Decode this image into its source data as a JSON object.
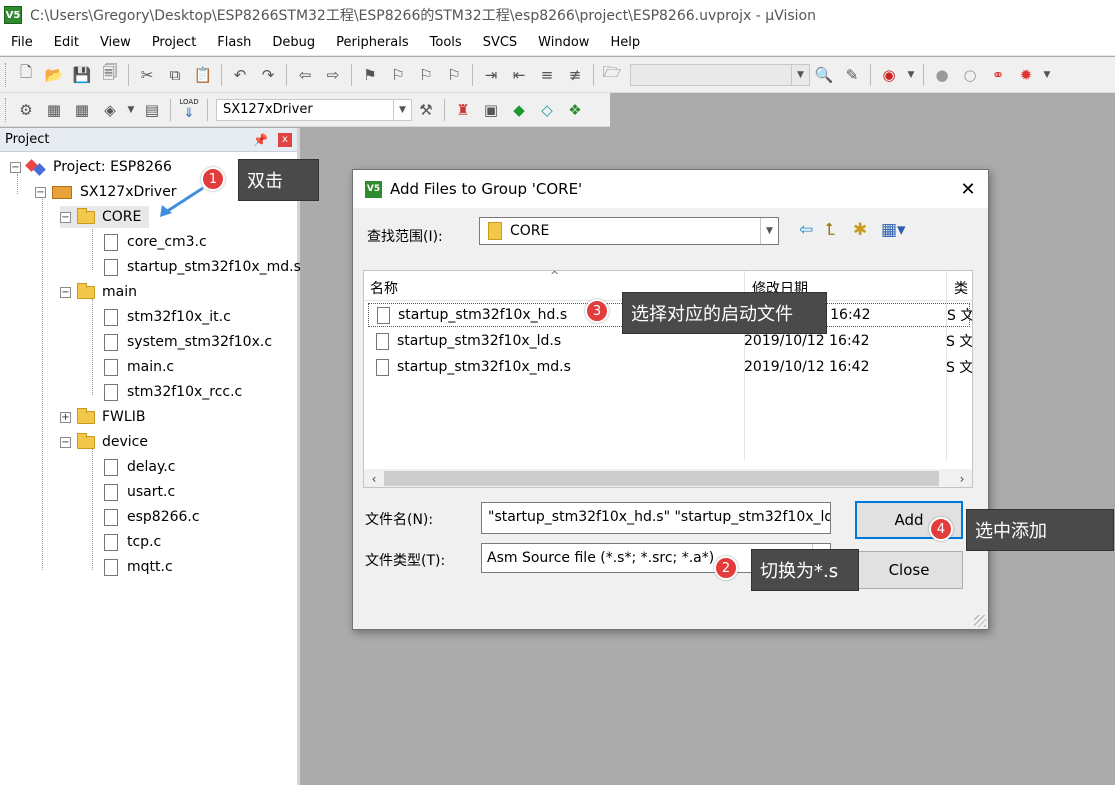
{
  "window": {
    "title": "C:\\Users\\Gregory\\Desktop\\ESP8266STM32工程\\ESP8266的STM32工程\\esp8266\\project\\ESP8266.uvprojx - µVision",
    "icon_label": "V5"
  },
  "menu": [
    "File",
    "Edit",
    "View",
    "Project",
    "Flash",
    "Debug",
    "Peripherals",
    "Tools",
    "SVCS",
    "Window",
    "Help"
  ],
  "toolbar2": {
    "target": "SX127xDriver",
    "load_label": "LOAD"
  },
  "project_panel": {
    "title": "Project",
    "pin": "ᵖ",
    "close": "x",
    "project_label": "Project: ESP8266",
    "target": "SX127xDriver",
    "groups": [
      {
        "name": "CORE",
        "expanded": "−",
        "files": [
          "core_cm3.c",
          "startup_stm32f10x_md.s"
        ]
      },
      {
        "name": "main",
        "expanded": "−",
        "files": [
          "stm32f10x_it.c",
          "system_stm32f10x.c",
          "main.c",
          "stm32f10x_rcc.c"
        ]
      },
      {
        "name": "FWLIB",
        "expanded": "+",
        "files": []
      },
      {
        "name": "device",
        "expanded": "−",
        "files": [
          "delay.c",
          "usart.c",
          "esp8266.c",
          "tcp.c",
          "mqtt.c"
        ]
      }
    ]
  },
  "dialog": {
    "title": "Add Files to Group 'CORE'",
    "close": "✕",
    "look_in_label": "查找范围(I):",
    "look_in_value": "CORE",
    "columns": {
      "name": "名称",
      "date": "修改日期",
      "type": "类"
    },
    "files": [
      {
        "name": "startup_stm32f10x_hd.s",
        "date": "2019/10/12 16:42",
        "type": "S 文"
      },
      {
        "name": "startup_stm32f10x_ld.s",
        "date": "2019/10/12 16:42",
        "type": "S 文"
      },
      {
        "name": "startup_stm32f10x_md.s",
        "date": "2019/10/12 16:42",
        "type": "S 文"
      }
    ],
    "filename_label": "文件名(N):",
    "filename_value": "\"startup_stm32f10x_hd.s\" \"startup_stm32f10x_ld",
    "filetype_label": "文件类型(T):",
    "filetype_value": "Asm Source file (*.s*; *.src; *.a*)",
    "add_button": "Add",
    "close_button": "Close"
  },
  "annotations": [
    {
      "num": "1",
      "text": "双击"
    },
    {
      "num": "2",
      "text": "切换为*.s"
    },
    {
      "num": "3",
      "text": "选择对应的启动文件"
    },
    {
      "num": "4",
      "text": "选中添加"
    }
  ],
  "colors": {
    "badge": "#e23c3c",
    "callout_bg": "#4a4a4a",
    "selection": "#0078d7"
  }
}
